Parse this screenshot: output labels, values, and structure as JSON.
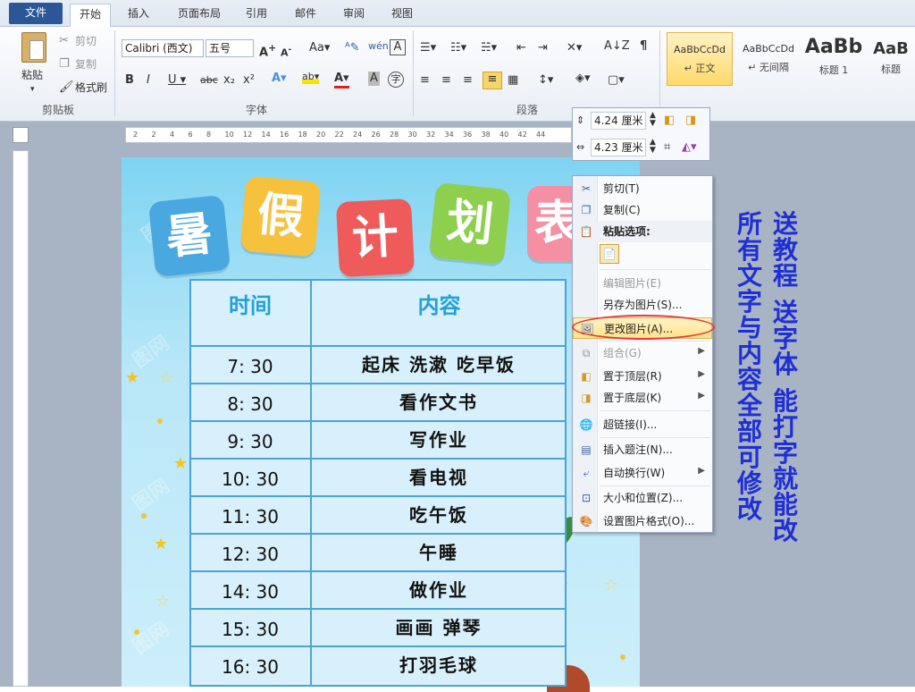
{
  "tabs": {
    "file": "文件",
    "items": [
      "开始",
      "插入",
      "页面布局",
      "引用",
      "邮件",
      "审阅",
      "视图"
    ]
  },
  "clipboard": {
    "paste": "粘贴",
    "cut": "剪切",
    "copy": "复制",
    "format_painter": "格式刷",
    "group": "剪贴板"
  },
  "font": {
    "name": "Calibri (西文)",
    "size": "五号",
    "group": "字体"
  },
  "paragraph": {
    "group": "段落"
  },
  "styles": [
    {
      "sample": "AaBbCcDd",
      "name": "↵ 正文"
    },
    {
      "sample": "AaBbCcDd",
      "name": "↵ 无间隔"
    },
    {
      "sample": "AaBb",
      "name": "标题 1"
    },
    {
      "sample": "AaB",
      "name": "标题"
    }
  ],
  "size_bar": {
    "height": "4.24 厘米",
    "width": "4.23 厘米"
  },
  "ruler": {
    "ticks": [
      "2",
      "2",
      "4",
      "6",
      "8",
      "10",
      "12",
      "14",
      "16",
      "18",
      "20",
      "22",
      "24",
      "26",
      "28",
      "30",
      "32",
      "34",
      "36",
      "38",
      "40",
      "42",
      "44"
    ]
  },
  "poster": {
    "title_chars": [
      "暑",
      "假",
      "计",
      "划",
      "表"
    ],
    "tile_colors": [
      "#4aa8e0",
      "#f6c23e",
      "#ef5b5b",
      "#8fcf4e",
      "#f58fa4"
    ],
    "header_time": "时间",
    "header_content": "内容",
    "rows": [
      {
        "time": "7: 30",
        "content": "起床  洗漱  吃早饭"
      },
      {
        "time": "8: 30",
        "content": "看作文书"
      },
      {
        "time": "9: 30",
        "content": "写作业"
      },
      {
        "time": "10: 30",
        "content": "看电视"
      },
      {
        "time": "11: 30",
        "content": "吃午饭"
      },
      {
        "time": "12: 30",
        "content": "午睡"
      },
      {
        "time": "14: 30",
        "content": "做作业"
      },
      {
        "time": "15: 30",
        "content": "画画  弹琴"
      },
      {
        "time": "16: 30",
        "content": "打羽毛球"
      }
    ]
  },
  "context_menu": {
    "cut": "剪切(T)",
    "copy": "复制(C)",
    "paste_options": "粘贴选项:",
    "edit_picture": "编辑图片(E)",
    "save_as_picture": "另存为图片(S)...",
    "change_picture": "更改图片(A)...",
    "group": "组合(G)",
    "bring_to_front": "置于顶层(R)",
    "send_to_back": "置于底层(K)",
    "hyperlink": "超链接(I)...",
    "insert_caption": "插入题注(N)...",
    "wrap_text": "自动换行(W)",
    "size_position": "大小和位置(Z)...",
    "format_picture": "设置图片格式(O)..."
  },
  "promo": {
    "line1": "送教程 送字体 能打字就能改",
    "line2": "所有文字与内容全部可修改"
  }
}
